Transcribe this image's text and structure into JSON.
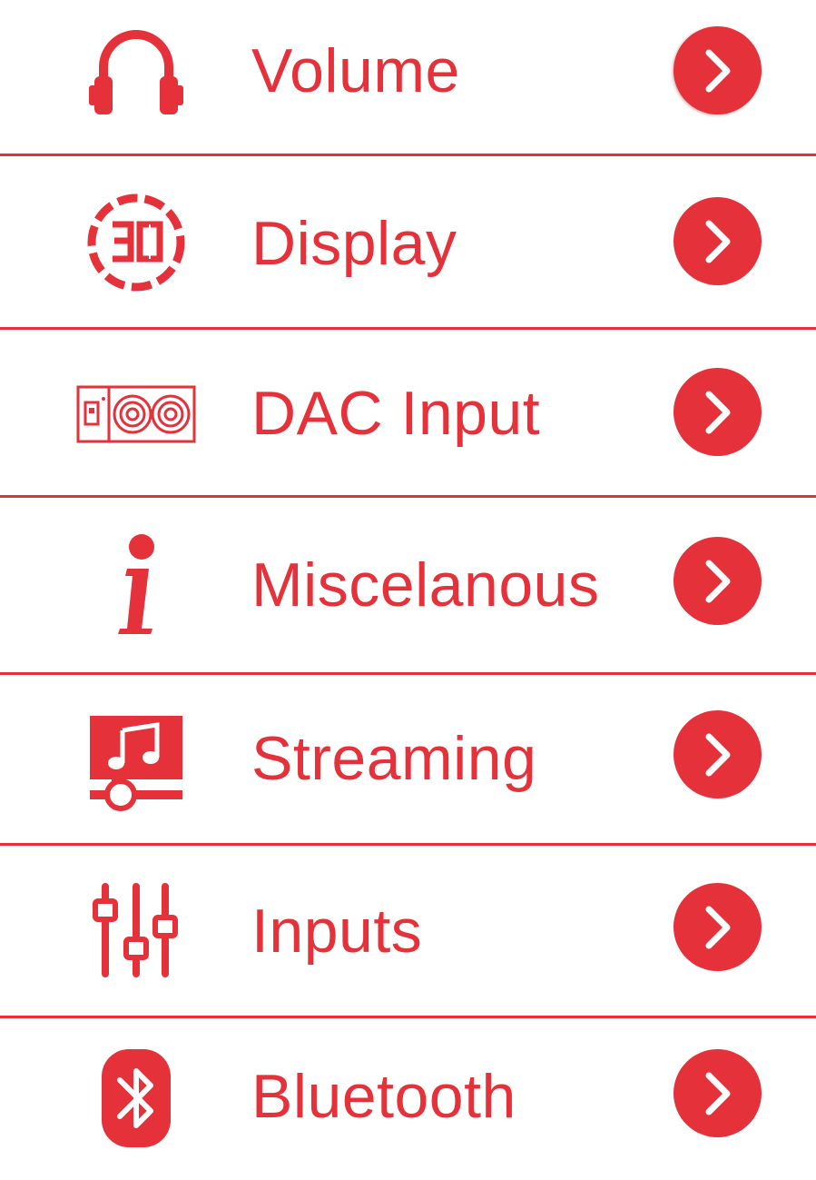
{
  "accent_color": "#e4313a",
  "menu": {
    "items": [
      {
        "label": "Volume",
        "icon": "headphones-icon"
      },
      {
        "label": "Display",
        "icon": "display-segment-icon"
      },
      {
        "label": "DAC Input",
        "icon": "dac-device-icon"
      },
      {
        "label": "Miscelanous",
        "icon": "info-icon"
      },
      {
        "label": "Streaming",
        "icon": "streaming-music-icon"
      },
      {
        "label": "Inputs",
        "icon": "sliders-icon"
      },
      {
        "label": "Bluetooth",
        "icon": "bluetooth-icon"
      }
    ],
    "arrow_icon": "chevron-right-icon"
  }
}
